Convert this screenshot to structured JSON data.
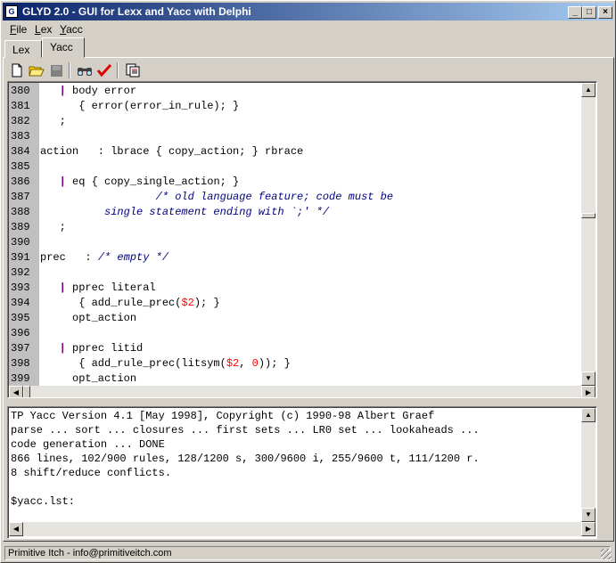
{
  "window": {
    "title": "GLYD 2.0 - GUI for Lexx and Yacc with Delphi"
  },
  "menu": [
    {
      "underline": "F",
      "rest": "ile"
    },
    {
      "underline": "L",
      "rest": "ex"
    },
    {
      "underline": "Y",
      "rest": "acc"
    }
  ],
  "tabs": [
    {
      "label": "Lex",
      "active": false
    },
    {
      "label": "Yacc",
      "active": true
    }
  ],
  "toolbar": {
    "icons": [
      "new-file-icon",
      "open-folder-icon",
      "save-disabled-icon",
      "find-binoculars-icon",
      "check-icon",
      "report-icon"
    ]
  },
  "editor": {
    "lines": [
      {
        "n": "380",
        "parts": [
          [
            "",
            "   "
          ],
          [
            "bar",
            "|"
          ],
          [
            "",
            " body error"
          ]
        ]
      },
      {
        "n": "381",
        "parts": [
          [
            "",
            "      { error(error_in_rule); }"
          ]
        ]
      },
      {
        "n": "382",
        "parts": [
          [
            "",
            "   ;"
          ]
        ]
      },
      {
        "n": "383",
        "parts": []
      },
      {
        "n": "384",
        "parts": [
          [
            "",
            "action   : lbrace { copy_action; } rbrace"
          ]
        ]
      },
      {
        "n": "385",
        "parts": []
      },
      {
        "n": "386",
        "parts": [
          [
            "",
            "   "
          ],
          [
            "bar",
            "|"
          ],
          [
            "",
            " eq { copy_single_action; }"
          ]
        ]
      },
      {
        "n": "387",
        "parts": [
          [
            "",
            "                  "
          ],
          [
            "cmt",
            "/* old language feature; code must be"
          ]
        ]
      },
      {
        "n": "388",
        "parts": [
          [
            "cmt",
            "          single statement ending with `;' */"
          ]
        ]
      },
      {
        "n": "389",
        "parts": [
          [
            "",
            "   ;"
          ]
        ]
      },
      {
        "n": "390",
        "parts": []
      },
      {
        "n": "391",
        "parts": [
          [
            "",
            "prec   : "
          ],
          [
            "cmt",
            "/* empty */"
          ]
        ]
      },
      {
        "n": "392",
        "parts": []
      },
      {
        "n": "393",
        "parts": [
          [
            "",
            "   "
          ],
          [
            "bar",
            "|"
          ],
          [
            "",
            " pprec literal"
          ]
        ]
      },
      {
        "n": "394",
        "parts": [
          [
            "",
            "      { add_rule_prec("
          ],
          [
            "num",
            "$2"
          ],
          [
            "",
            "); }"
          ]
        ]
      },
      {
        "n": "395",
        "parts": [
          [
            "",
            "     opt_action"
          ]
        ]
      },
      {
        "n": "396",
        "parts": []
      },
      {
        "n": "397",
        "parts": [
          [
            "",
            "   "
          ],
          [
            "bar",
            "|"
          ],
          [
            "",
            " pprec litid"
          ]
        ]
      },
      {
        "n": "398",
        "parts": [
          [
            "",
            "      { add_rule_prec(litsym("
          ],
          [
            "num",
            "$2"
          ],
          [
            "",
            ", "
          ],
          [
            "num",
            "0"
          ],
          [
            "",
            ")); }"
          ]
        ]
      },
      {
        "n": "399",
        "parts": [
          [
            "",
            "     opt_action"
          ]
        ]
      }
    ]
  },
  "output": {
    "lines": [
      "TP Yacc Version 4.1 [May 1998], Copyright (c) 1990-98 Albert Graef",
      "parse ... sort ... closures ... first sets ... LR0 set ... lookaheads ...",
      "code generation ... DONE",
      "866 lines, 102/900 rules, 128/1200 s, 300/9600 i, 255/9600 t, 111/1200 r.",
      "8 shift/reduce conflicts.",
      "",
      "$yacc.lst:"
    ]
  },
  "statusbar": {
    "text": "Primitive Itch - info@primitiveitch.com"
  }
}
